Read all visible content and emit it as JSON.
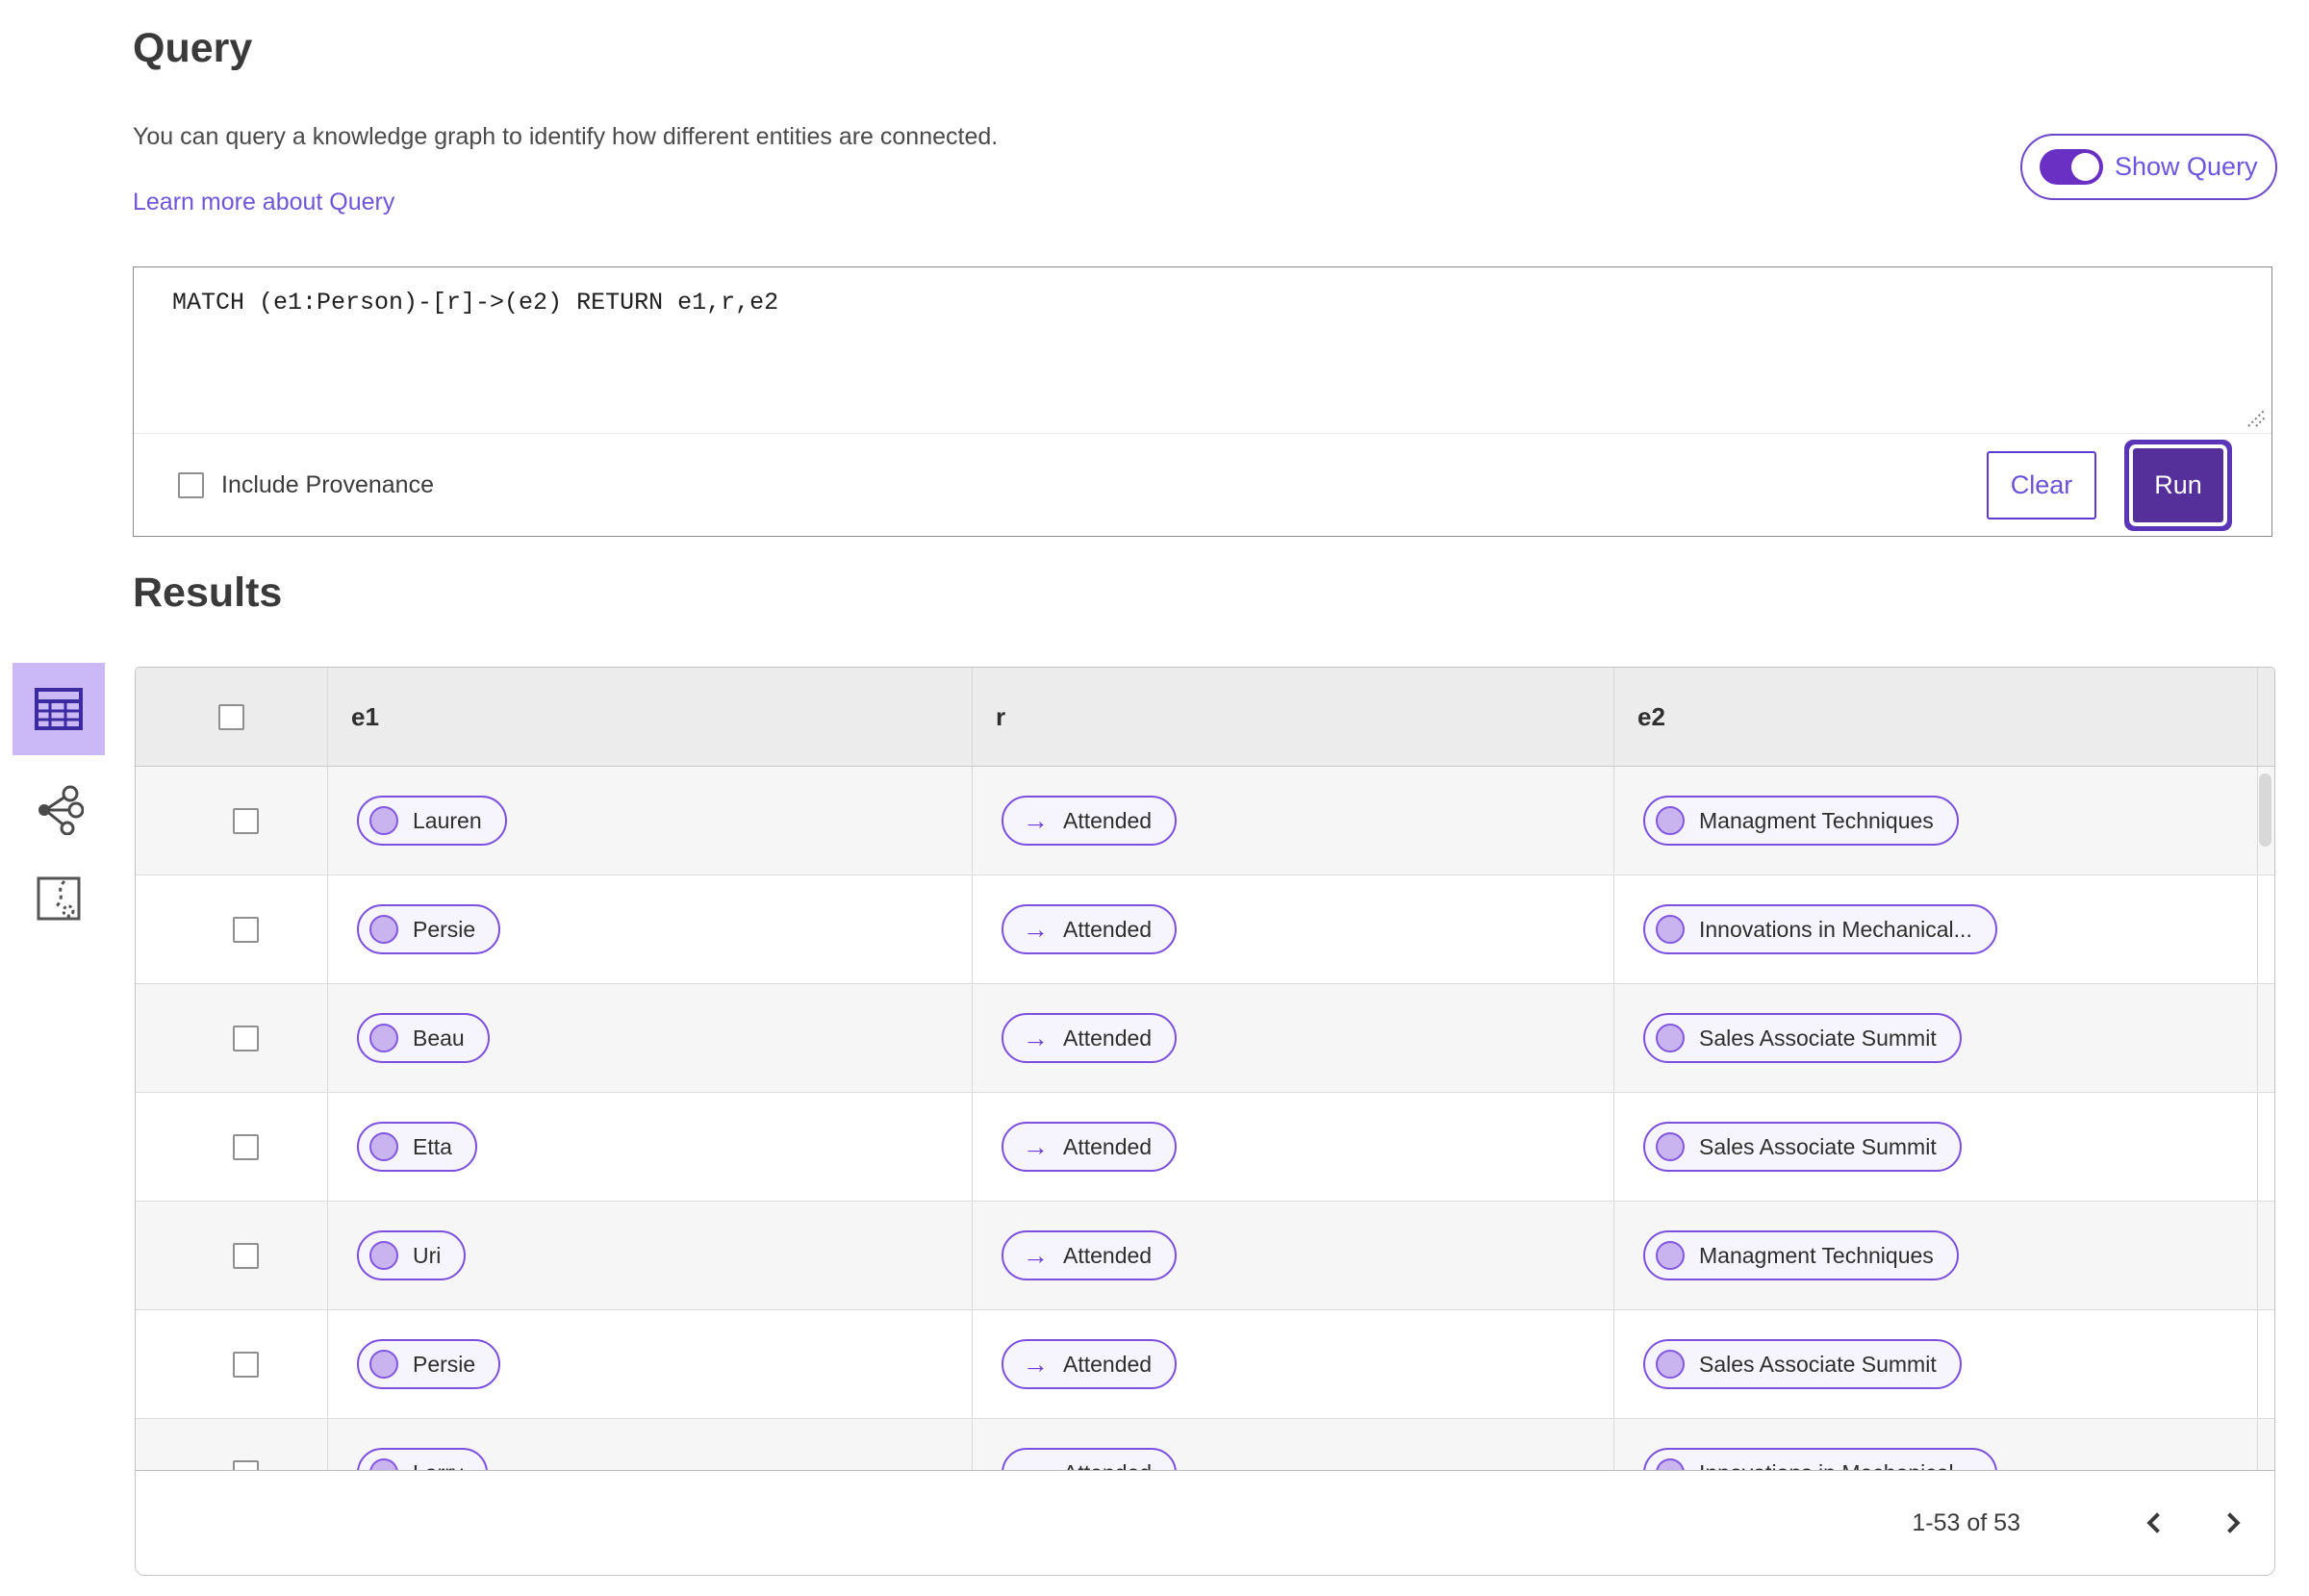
{
  "colors": {
    "accent": "#5f35c8",
    "run_fill": "#55309b",
    "toggle_fill": "#6930c3",
    "link": "#6f56d8",
    "selected_view_bg": "#cbb8f6",
    "pill_border": "#7a50dc",
    "pill_bg": "#f6f4fd",
    "circle_fill": "#c9b4f0",
    "circle_border": "#8257e0",
    "header_bg": "#ececec",
    "row_alt_bg": "#f6f6f6"
  },
  "query": {
    "title": "Query",
    "description": "You can query a knowledge graph to identify how different entities are connected.",
    "learn_more_link": "Learn more about Query",
    "show_query_label": "Show Query",
    "show_query_on": true,
    "query_text": "MATCH (e1:Person)-[r]->(e2) RETURN e1,r,e2",
    "include_provenance_label": "Include Provenance",
    "include_provenance_checked": false,
    "clear_button": "Clear",
    "run_button": "Run"
  },
  "results": {
    "title": "Results",
    "views": [
      {
        "name": "table-view",
        "selected": true
      },
      {
        "name": "network-view",
        "selected": false
      },
      {
        "name": "map-view",
        "selected": false
      }
    ],
    "table": {
      "columns": [
        "e1",
        "r",
        "e2"
      ],
      "relation_arrow": "→",
      "rows": [
        {
          "e1": "Lauren",
          "r": "Attended",
          "e2": "Managment Techniques"
        },
        {
          "e1": "Persie",
          "r": "Attended",
          "e2": "Innovations in Mechanical..."
        },
        {
          "e1": "Beau",
          "r": "Attended",
          "e2": "Sales Associate Summit"
        },
        {
          "e1": "Etta",
          "r": "Attended",
          "e2": "Sales Associate Summit"
        },
        {
          "e1": "Uri",
          "r": "Attended",
          "e2": "Managment Techniques"
        },
        {
          "e1": "Persie",
          "r": "Attended",
          "e2": "Sales Associate Summit"
        },
        {
          "e1": "Larry",
          "r": "Attended",
          "e2": "Innovations in Mechanical..."
        }
      ]
    },
    "pagination": {
      "range_label": "1-53 of 53"
    }
  }
}
